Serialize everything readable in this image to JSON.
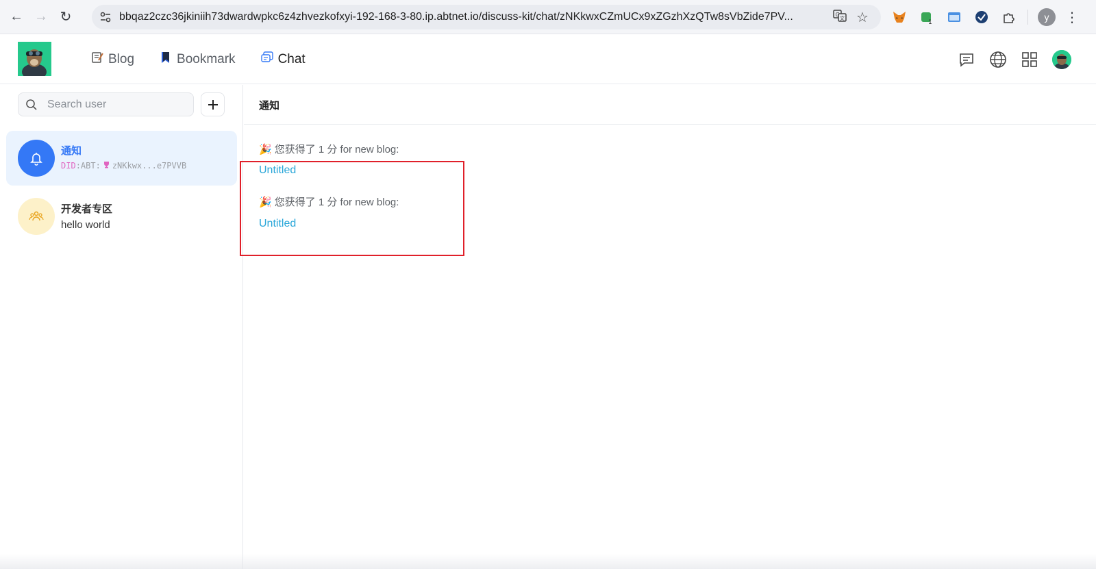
{
  "browser": {
    "url": "bbqaz2czc36jkiniih73dwardwpkc6z4zhvezkofxyi-192-168-3-80.ip.abtnet.io/discuss-kit/chat/zNKkwxCZmUCx9xZGzhXzQTw8sVbZide7PV...",
    "profile_initial": "y"
  },
  "header": {
    "nav": [
      {
        "label": "Blog"
      },
      {
        "label": "Bookmark"
      },
      {
        "label": "Chat"
      }
    ]
  },
  "sidebar": {
    "search_placeholder": "Search user",
    "conversations": [
      {
        "title": "通知",
        "did_prefix": "DID",
        "did_sep": ":ABT:",
        "did_value": "zNKkwx...e7PVVB"
      },
      {
        "title": "开发者专区",
        "preview": "hello world"
      }
    ]
  },
  "chat": {
    "title": "通知",
    "messages": [
      {
        "text": "您获得了 1 分 for new blog:",
        "link": "Untitled"
      },
      {
        "text": "您获得了 1 分 for new blog:",
        "link": "Untitled"
      }
    ]
  },
  "colors": {
    "accent": "#3478f6",
    "link": "#2aa7d9",
    "highlight": "#e0202a"
  }
}
